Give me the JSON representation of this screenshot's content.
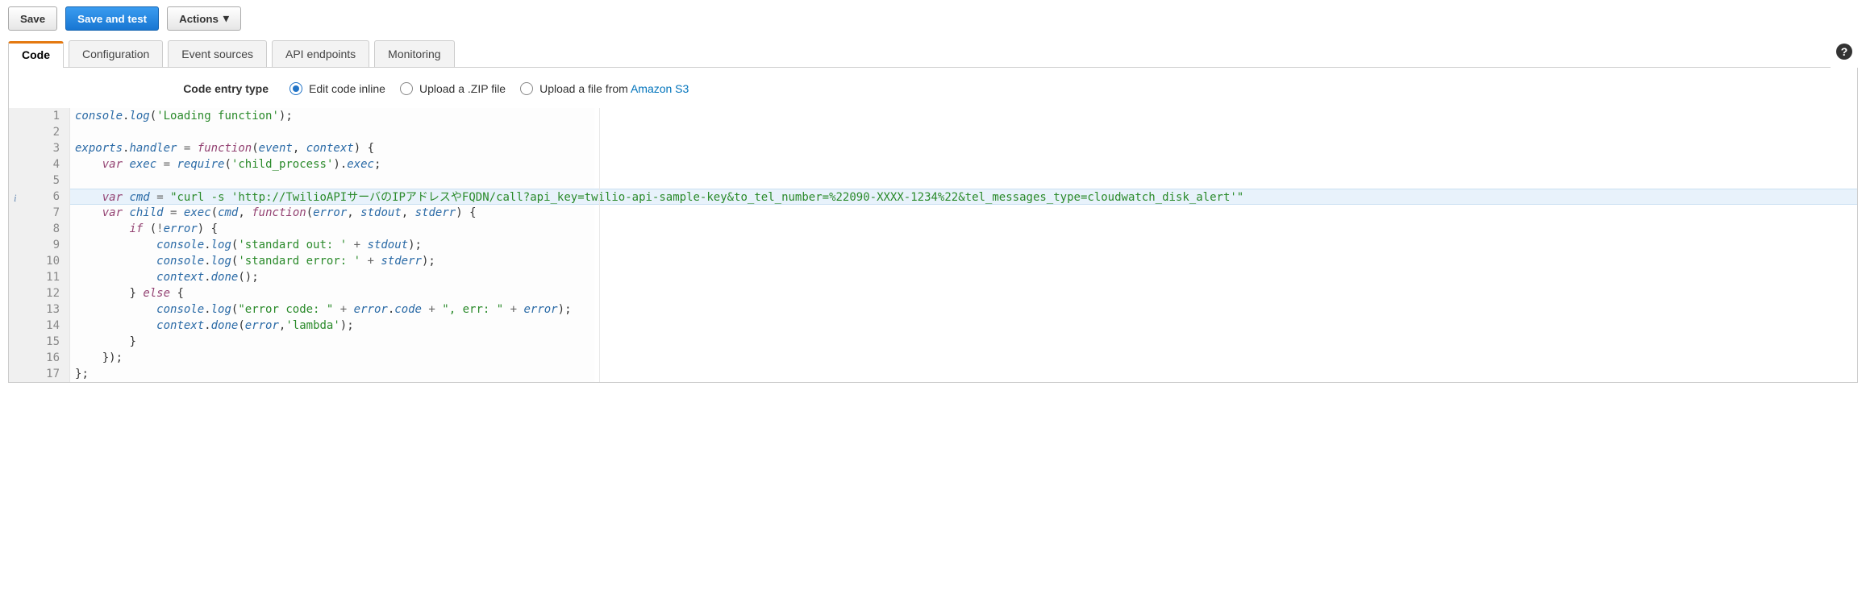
{
  "toolbar": {
    "save_label": "Save",
    "save_test_label": "Save and test",
    "actions_label": "Actions"
  },
  "tabs": {
    "code": "Code",
    "configuration": "Configuration",
    "event_sources": "Event sources",
    "api_endpoints": "API endpoints",
    "monitoring": "Monitoring"
  },
  "help_icon_glyph": "?",
  "entry": {
    "label": "Code entry type",
    "opt_inline": "Edit code inline",
    "opt_zip": "Upload a .ZIP file",
    "opt_s3_prefix": "Upload a file from ",
    "opt_s3_link": "Amazon S3"
  },
  "editor": {
    "highlighted_line": 6,
    "lines": [
      "console.log('Loading function');",
      "",
      "exports.handler = function(event, context) {",
      "    var exec = require('child_process').exec;",
      "",
      "    var cmd = \"curl -s 'http://TwilioAPIサーバのIPアドレスやFQDN/call?api_key=twilio-api-sample-key&to_tel_number=%22090-XXXX-1234%22&tel_messages_type=cloudwatch_disk_alert'\"",
      "    var child = exec(cmd, function(error, stdout, stderr) {",
      "        if (!error) {",
      "            console.log('standard out: ' + stdout);",
      "            console.log('standard error: ' + stderr);",
      "            context.done();",
      "        } else {",
      "            console.log(\"error code: \" + error.code + \", err: \" + error);",
      "            context.done(error,'lambda');",
      "        }",
      "    });",
      "};"
    ]
  }
}
